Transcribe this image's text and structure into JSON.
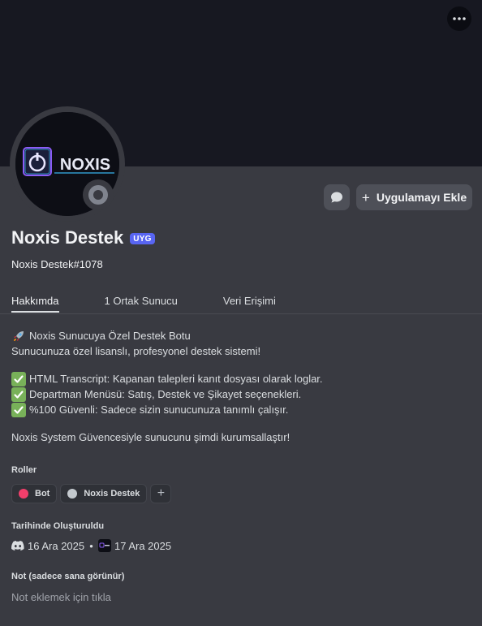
{
  "header": {
    "more_label": "More"
  },
  "profile": {
    "display_name": "Noxis Destek",
    "app_badge": "UYG",
    "username": "Noxis Destek#1078",
    "avatar_text": "NOXIS",
    "status": "offline"
  },
  "actions": {
    "message_icon": "chat-bubble-icon",
    "add_app_label": "Uygulamayı Ekle"
  },
  "tabs": [
    {
      "label": "Hakkımda",
      "active": true
    },
    {
      "label": "1 Ortak Sunucu",
      "active": false
    },
    {
      "label": "Veri Erişimi",
      "active": false
    }
  ],
  "bio": {
    "line1": "Noxis Sunucuya Özel Destek Botu",
    "line2": "Sunucunuza özel lisanslı, profesyonel destek sistemi!",
    "features": [
      "HTML Transcript: Kapanan talepleri kanıt dosyası olarak loglar.",
      "Departman Menüsü: Satış, Destek ve Şikayet seçenekleri.",
      "%100 Güvenli: Sadece sizin sunucunuza tanımlı çalışır."
    ],
    "closing": "Noxis System Güvencesiyle sunucunu şimdi kurumsallaştır!"
  },
  "roles": {
    "title": "Roller",
    "items": [
      {
        "name": "Bot",
        "color": "#f23f6b"
      },
      {
        "name": "Noxis Destek",
        "color": "#c4c9ce"
      }
    ]
  },
  "created": {
    "title": "Tarihinde Oluşturuldu",
    "discord_date": "16 Ara 2025",
    "server_date": "17 Ara 2025"
  },
  "note": {
    "title": "Not (sadece sana görünür)",
    "placeholder": "Not eklemek için tıkla"
  },
  "colors": {
    "banner": "#171821",
    "panel": "#393a41",
    "badge": "#5865f2",
    "check": "#78b159"
  }
}
